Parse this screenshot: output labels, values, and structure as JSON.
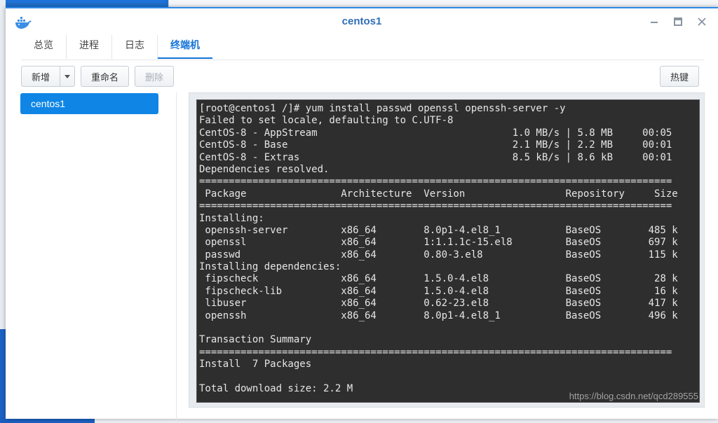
{
  "window": {
    "title": "centos1"
  },
  "tabs": [
    {
      "label": "总览"
    },
    {
      "label": "进程"
    },
    {
      "label": "日志"
    },
    {
      "label": "终端机"
    }
  ],
  "toolbar": {
    "new_label": "新增",
    "rename_label": "重命名",
    "delete_label": "删除",
    "hotkey_label": "热键"
  },
  "sidebar": {
    "items": [
      {
        "label": "centos1"
      }
    ]
  },
  "terminal": {
    "lines": [
      "[root@centos1 /]# yum install passwd openssl openssh-server -y",
      "Failed to set locale, defaulting to C.UTF-8",
      "CentOS-8 - AppStream                                 1.0 MB/s | 5.8 MB     00:05",
      "CentOS-8 - Base                                      2.1 MB/s | 2.2 MB     00:01",
      "CentOS-8 - Extras                                    8.5 kB/s | 8.6 kB     00:01",
      "Dependencies resolved.",
      "================================================================================",
      " Package                Architecture  Version                 Repository     Size",
      "================================================================================",
      "Installing:",
      " openssh-server         x86_64        8.0p1-4.el8_1           BaseOS        485 k",
      " openssl                x86_64        1:1.1.1c-15.el8         BaseOS        697 k",
      " passwd                 x86_64        0.80-3.el8              BaseOS        115 k",
      "Installing dependencies:",
      " fipscheck              x86_64        1.5.0-4.el8             BaseOS         28 k",
      " fipscheck-lib          x86_64        1.5.0-4.el8             BaseOS         16 k",
      " libuser                x86_64        0.62-23.el8             BaseOS        417 k",
      " openssh                x86_64        8.0p1-4.el8_1           BaseOS        496 k",
      "",
      "Transaction Summary",
      "================================================================================",
      "Install  7 Packages",
      "",
      "Total download size: 2.2 M"
    ],
    "watermark": "https://blog.csdn.net/qcd289555"
  },
  "colors": {
    "accent": "#1673d8",
    "selected_item": "#0f86e6",
    "terminal_bg": "#2e2e2e",
    "terminal_fg": "#e6e6e6",
    "title": "#2f6db5"
  },
  "icons": {
    "app": "docker-whale-icon",
    "minimize": "minimize-icon",
    "maximize": "maximize-icon",
    "close": "close-icon",
    "dropdown": "chevron-down-icon"
  }
}
